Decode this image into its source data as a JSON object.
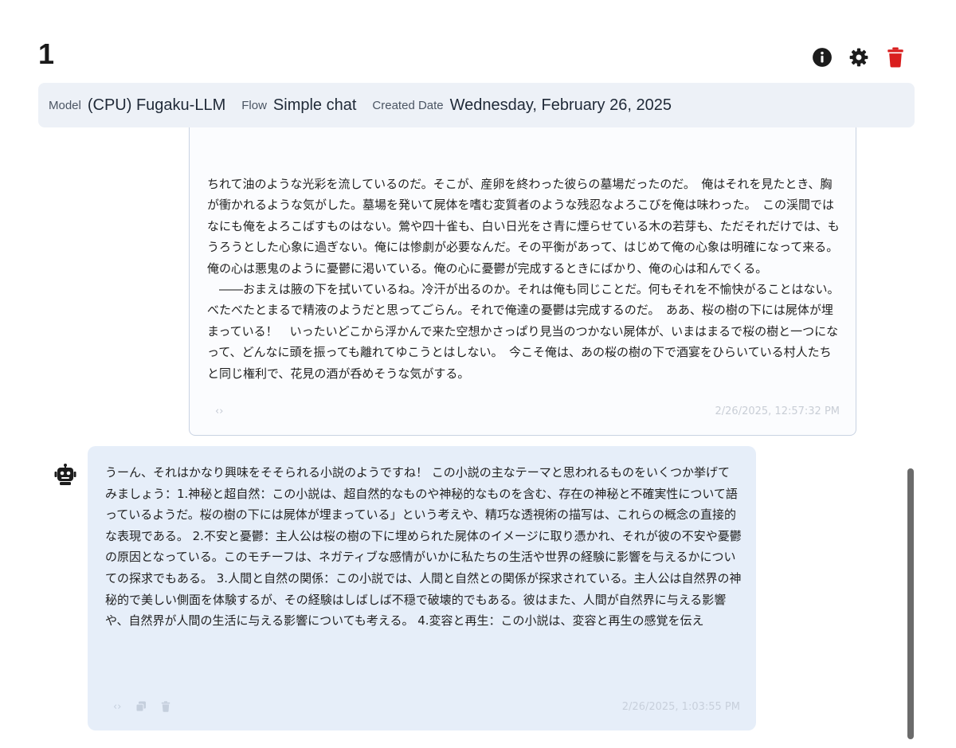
{
  "header": {
    "title": "1",
    "actions": {
      "info_icon": "info-circle",
      "settings_icon": "gear",
      "delete_icon": "trash",
      "delete_color": "#d91e1e"
    }
  },
  "info_bar": {
    "model_label": "Model",
    "model_value": "(CPU) Fugaku-LLM",
    "flow_label": "Flow",
    "flow_value": "Simple chat",
    "date_label": "Created Date",
    "date_value": "Wednesday, February 26, 2025"
  },
  "messages": [
    {
      "role": "user",
      "text": "ちれて油のような光彩を流しているのだ。そこが、産卵を終わった彼らの墓場だったのだ。　俺はそれを見たとき、胸が衝かれるような気がした。墓場を発いて屍体を嗜む変質者のような残忍なよろこびを俺は味わった。　この渓間ではなにも俺をよろこばすものはない。鶯や四十雀も、白い日光をさ青に煙らせている木の若芽も、ただそれだけでは、もうろうとした心象に過ぎない。俺には惨劇が必要なんだ。その平衡があって、はじめて俺の心象は明確になって来る。俺の心は悪鬼のように憂鬱に渇いている。俺の心に憂鬱が完成するときにばかり、俺の心は和んでくる。\n　――おまえは腋の下を拭いているね。冷汗が出るのか。それは俺も同じことだ。何もそれを不愉快がることはない。べたべたとまるで精液のようだと思ってごらん。それで俺達の憂鬱は完成するのだ。　ああ、桜の樹の下には屍体が埋まっている！　いったいどこから浮かんで来た空想かさっぱり見当のつかない屍体が、いまはまるで桜の樹と一つになって、どんなに頭を振っても離れてゆこうとはしない。　今こそ俺は、あの桜の樹の下で酒宴をひらいている村人たちと同じ権利で、花見の酒が呑めそうな気がする。",
      "timestamp": "2/26/2025, 12:57:32 PM"
    },
    {
      "role": "assistant",
      "text": "うーん、それはかなり興味をそそられる小説のようですね！ この小説の主なテーマと思われるものをいくつか挙げてみましょう：1.神秘と超自然：この小説は、超自然的なものや神秘的なものを含む、存在の神秘と不確実性について語っているようだ。桜の樹の下には屍体が埋まっている」という考えや、精巧な透視術の描写は、これらの概念の直接的な表現である。 2.不安と憂鬱：主人公は桜の樹の下に埋められた屍体のイメージに取り憑かれ、それが彼の不安や憂鬱の原因となっている。このモチーフは、ネガティブな感情がいかに私たちの生活や世界の経験に影響を与えるかについての探求でもある。 3.人間と自然の関係：この小説では、人間と自然との関係が探求されている。主人公は自然界の神秘的で美しい側面を体験するが、その経験はしばしば不穏で破壊的でもある。彼はまた、人間が自然界に与える影響や、自然界が人間の生活に与える影響についても考える。 4.変容と再生：この小説は、変容と再生の感覚を伝え",
      "timestamp": "2/26/2025, 1:03:55 PM"
    }
  ],
  "footer_icons": {
    "code": "‹›",
    "copy": "copy-icon",
    "delete": "trash-icon"
  }
}
